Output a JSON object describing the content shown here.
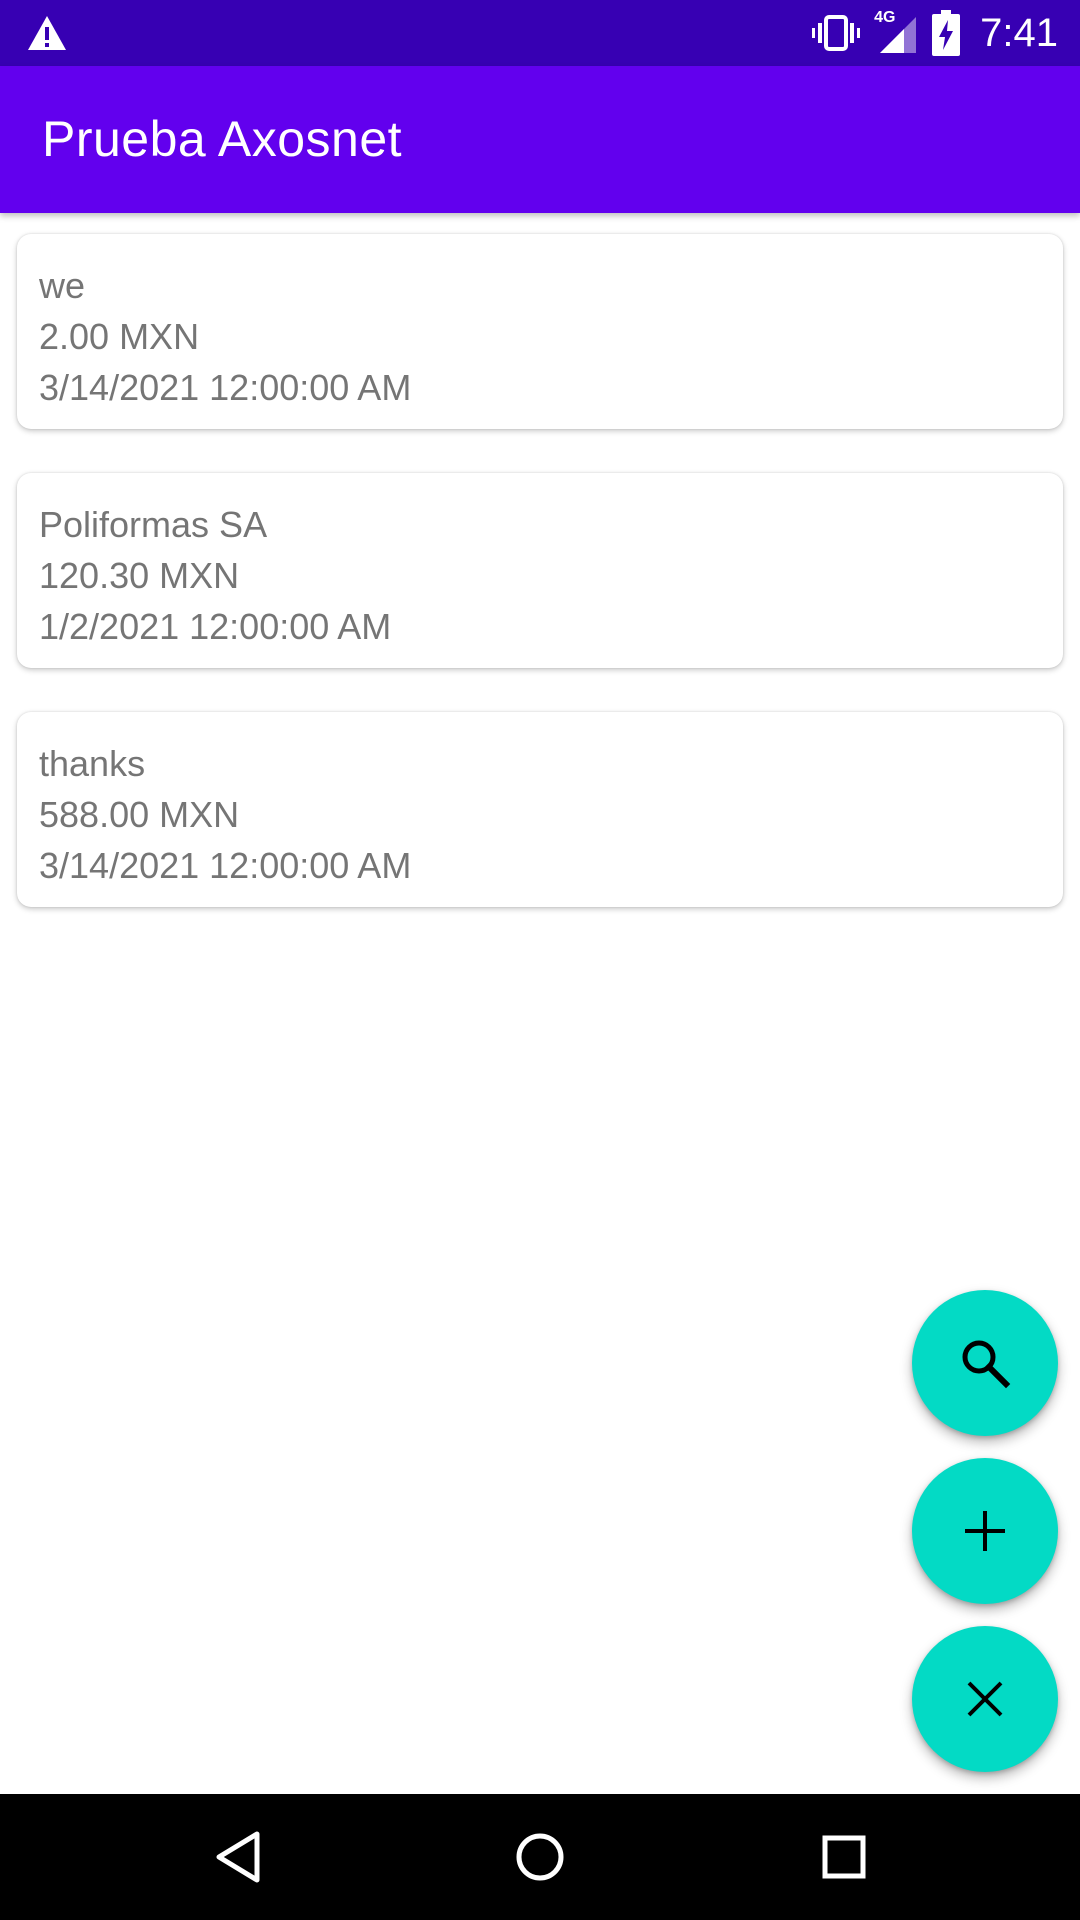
{
  "status_bar": {
    "time": "7:41",
    "network_label": "4G",
    "icons": [
      "warning-icon",
      "vibrate-icon",
      "signal-icon",
      "battery-charging-icon"
    ]
  },
  "app_bar": {
    "title": "Prueba Axosnet",
    "color": "#6200ee"
  },
  "receipts": [
    {
      "provider": "we",
      "amount": "2.00 MXN",
      "date": "3/14/2021 12:00:00 AM"
    },
    {
      "provider": "Poliformas SA",
      "amount": "120.30 MXN",
      "date": "1/2/2021 12:00:00 AM"
    },
    {
      "provider": "thanks",
      "amount": "588.00 MXN",
      "date": "3/14/2021 12:00:00 AM"
    }
  ],
  "fabs": {
    "color": "#03dac5",
    "buttons": [
      {
        "icon": "search-icon"
      },
      {
        "icon": "plus-icon"
      },
      {
        "icon": "close-icon"
      }
    ]
  },
  "nav_bar": {
    "buttons": [
      "back-icon",
      "home-icon",
      "recents-icon"
    ]
  },
  "colors": {
    "status_bar": "#3700b3",
    "card_text": "#757575"
  }
}
